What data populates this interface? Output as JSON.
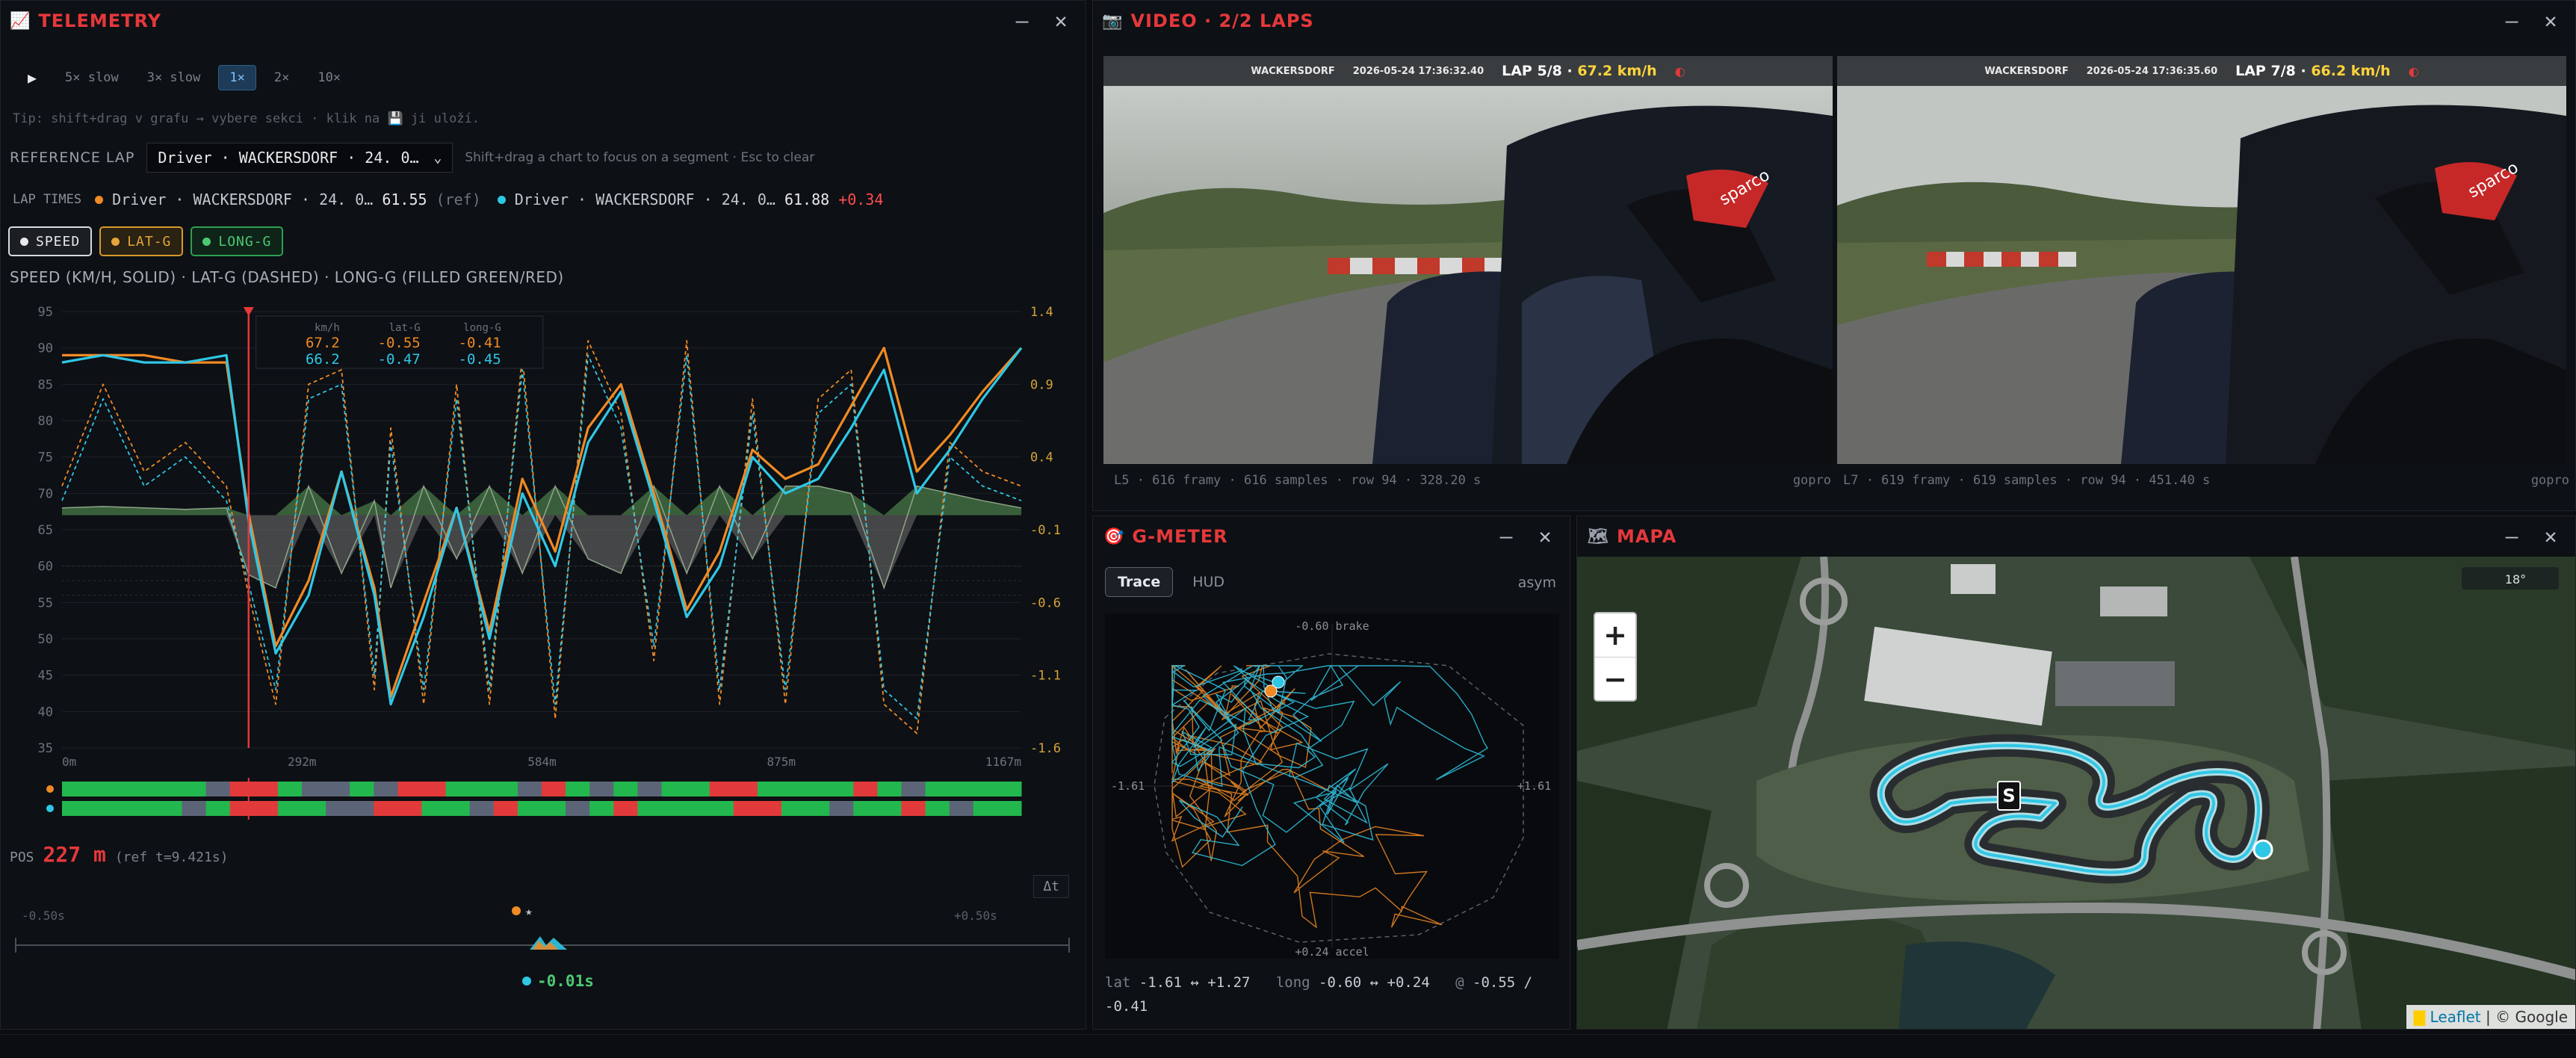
{
  "telemetry": {
    "title": "TELEMETRY",
    "play_icon": "▶",
    "speeds": [
      "5× slow",
      "3× slow",
      "1×",
      "2×",
      "10×"
    ],
    "active_speed_index": 2,
    "tip": "Tip: shift+drag v grafu → vybere sekci · klik na 💾 ji uloží.",
    "ref_label": "REFERENCE LAP",
    "ref_select": "Driver · WACKERSDORF · 24. 0…",
    "ref_hint": "Shift+drag a chart to focus on a segment · Esc to clear",
    "lap_times_label": "LAP TIMES",
    "lap1_name": "Driver · WACKERSDORF · 24. 0…",
    "lap1_time": "61.55",
    "lap1_tag": "(ref)",
    "lap2_name": "Driver · WACKERSDORF · 24. 0…",
    "lap2_time": "61.88",
    "lap2_delta": "+0.34",
    "chips": [
      "SPEED",
      "LAT-G",
      "LONG-G"
    ],
    "chart_title": "SPEED (KM/H, SOLID) · LAT-G (DASHED) · LONG-G (FILLED GREEN/RED)",
    "pos_label": "POS",
    "pos_value": "227 m",
    "pos_ref": "(ref t=9.421s)",
    "dt_button": "Δt",
    "delta_left": "-0.50s",
    "delta_right": "+0.50s",
    "delta_star": "★",
    "delta_value": "-0.01s"
  },
  "chart_data": {
    "type": "line",
    "title": "SPEED (KM/H, SOLID) · LAT-G (DASHED) · LONG-G (FILLED GREEN/RED)",
    "xlabel": "",
    "ylabel": "",
    "x_ticks": [
      "0m",
      "292m",
      "584m",
      "875m",
      "1167m"
    ],
    "xlim": [
      0,
      1167
    ],
    "ylim": [
      35,
      95
    ],
    "y_ticks": [
      95,
      90,
      85,
      80,
      75,
      70,
      65,
      60,
      55,
      50,
      45,
      40,
      35
    ],
    "y2_ticks": [
      "1.4",
      "0.9",
      "0.4",
      "-0.1",
      "-0.6",
      "-1.1",
      "-1.6"
    ],
    "y2lim": [
      -1.6,
      1.4
    ],
    "cursor_x": 227,
    "series_colors": {
      "lap1": "#f08a24",
      "lap2": "#2fc7e6",
      "long_pos": "#5f9e5a",
      "long_neg": "#6b6b6b"
    },
    "x": [
      0,
      50,
      100,
      150,
      200,
      227,
      260,
      300,
      340,
      380,
      400,
      440,
      480,
      520,
      560,
      600,
      640,
      680,
      720,
      760,
      800,
      840,
      880,
      920,
      960,
      1000,
      1040,
      1080,
      1120,
      1167
    ],
    "speed_lap1": [
      89,
      89,
      89,
      88,
      88,
      67.2,
      49,
      58,
      73,
      57,
      42,
      55,
      68,
      51,
      72,
      62,
      79,
      85,
      70,
      54,
      62,
      76,
      72,
      74,
      82,
      90,
      73,
      78,
      84,
      90
    ],
    "speed_lap2": [
      88,
      89,
      88,
      88,
      89,
      66.2,
      48,
      56,
      73,
      56,
      41,
      53,
      68,
      50,
      70,
      60,
      77,
      84,
      69,
      53,
      60,
      75,
      70,
      72,
      79,
      87,
      70,
      76,
      83,
      90
    ],
    "latg_lap1": [
      0.2,
      0.9,
      0.3,
      0.5,
      0.2,
      -0.55,
      -1.3,
      0.9,
      1.0,
      -1.2,
      0.6,
      -1.3,
      0.9,
      -1.3,
      1.1,
      -1.4,
      1.2,
      0.7,
      -1.0,
      1.2,
      -1.3,
      0.8,
      -1.3,
      0.8,
      1.0,
      -1.3,
      -1.5,
      0.5,
      0.3,
      0.2
    ],
    "latg_lap2": [
      0.1,
      0.8,
      0.2,
      0.4,
      0.1,
      -0.47,
      -1.2,
      0.8,
      0.9,
      -1.1,
      0.5,
      -1.2,
      0.8,
      -1.2,
      1.0,
      -1.3,
      1.1,
      0.6,
      -0.9,
      1.1,
      -1.2,
      0.7,
      -1.2,
      0.7,
      0.9,
      -1.2,
      -1.4,
      0.4,
      0.2,
      0.1
    ],
    "longg_lap1": [
      0.05,
      0.06,
      0.05,
      0.04,
      0.05,
      -0.41,
      -0.5,
      0.2,
      -0.4,
      0.1,
      -0.5,
      0.2,
      -0.3,
      0.2,
      -0.4,
      0.2,
      -0.3,
      -0.4,
      0.2,
      -0.4,
      0.2,
      -0.3,
      0.2,
      0.2,
      0.15,
      -0.5,
      0.2,
      0.15,
      0.1,
      0.05
    ],
    "readout": {
      "header": [
        "km/h",
        "lat-G",
        "long-G"
      ],
      "lap1": [
        "67.2",
        "-0.55",
        "-0.41"
      ],
      "lap2": [
        "66.2",
        "-0.47",
        "-0.45"
      ]
    }
  },
  "video": {
    "title": "VIDEO · 2/2 LAPS",
    "left": {
      "track": "WACKERSDORF",
      "date": "2026-05-24 17:36:32.40",
      "lap": "LAP 5/8",
      "speed": "67.2 km/h",
      "footer": "L5 · 616 framy · 616 samples · row 94 · 328.20 s",
      "source": "gopro"
    },
    "right": {
      "track": "WACKERSDORF",
      "date": "2026-05-24 17:36:35.60",
      "lap": "LAP 7/8",
      "speed": "66.2 km/h",
      "footer": "L7 · 619 framy · 619 samples · row 94 · 451.40 s",
      "source": "gopro"
    }
  },
  "gmeter": {
    "title": "G-METER",
    "tabs": [
      "Trace",
      "HUD"
    ],
    "asym": "asym",
    "top_label": "-0.60 brake",
    "bottom_label": "+0.24 accel",
    "left_label": "-1.61",
    "right_label": "+1.61",
    "foot_lat_k": "lat",
    "foot_lat_v": "-1.61 ↔ +1.27",
    "foot_long_k": "long",
    "foot_long_v": "-0.60 ↔ +0.24",
    "foot_at_k": "@",
    "foot_at_v": "-0.55 / -0.41"
  },
  "map": {
    "title": "MAPA",
    "zoom_in": "+",
    "zoom_out": "−",
    "marker": "S",
    "leaflet": "Leaflet",
    "google": "© Google",
    "heading": "18°"
  }
}
